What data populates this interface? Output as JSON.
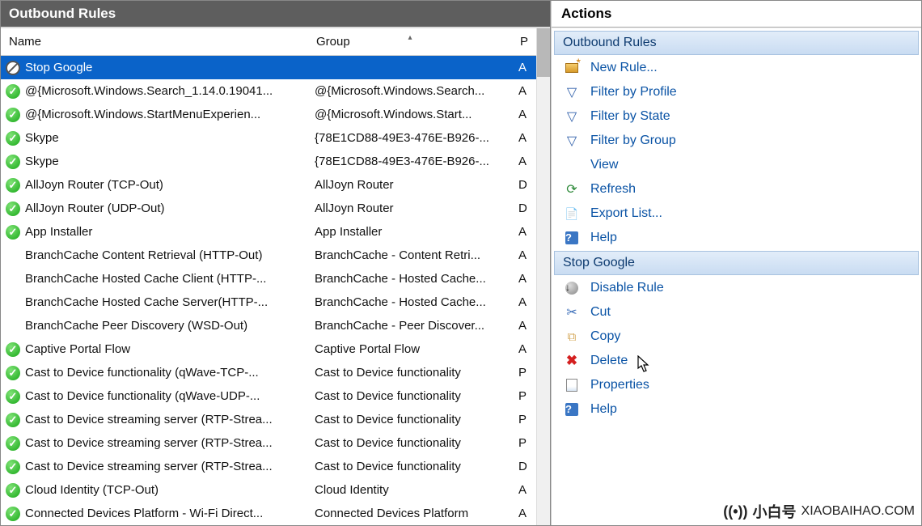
{
  "left": {
    "title": "Outbound Rules",
    "columns": {
      "name": "Name",
      "group": "Group",
      "p": "P"
    },
    "rows": [
      {
        "icon": "block",
        "name": "Stop Google",
        "group": "",
        "p": "A",
        "selected": true
      },
      {
        "icon": "allow",
        "name": "@{Microsoft.Windows.Search_1.14.0.19041...",
        "group": "@{Microsoft.Windows.Search...",
        "p": "A"
      },
      {
        "icon": "allow",
        "name": "@{Microsoft.Windows.StartMenuExperien...",
        "group": "@{Microsoft.Windows.Start...",
        "p": "A"
      },
      {
        "icon": "allow",
        "name": "Skype",
        "group": "{78E1CD88-49E3-476E-B926-...",
        "p": "A"
      },
      {
        "icon": "allow",
        "name": "Skype",
        "group": "{78E1CD88-49E3-476E-B926-...",
        "p": "A"
      },
      {
        "icon": "allow",
        "name": "AllJoyn Router (TCP-Out)",
        "group": "AllJoyn Router",
        "p": "D"
      },
      {
        "icon": "allow",
        "name": "AllJoyn Router (UDP-Out)",
        "group": "AllJoyn Router",
        "p": "D"
      },
      {
        "icon": "allow",
        "name": "App Installer",
        "group": "App Installer",
        "p": "A"
      },
      {
        "icon": "none",
        "name": "BranchCache Content Retrieval (HTTP-Out)",
        "group": "BranchCache - Content Retri...",
        "p": "A"
      },
      {
        "icon": "none",
        "name": "BranchCache Hosted Cache Client (HTTP-...",
        "group": "BranchCache - Hosted Cache...",
        "p": "A"
      },
      {
        "icon": "none",
        "name": "BranchCache Hosted Cache Server(HTTP-...",
        "group": "BranchCache - Hosted Cache...",
        "p": "A"
      },
      {
        "icon": "none",
        "name": "BranchCache Peer Discovery (WSD-Out)",
        "group": "BranchCache - Peer Discover...",
        "p": "A"
      },
      {
        "icon": "allow",
        "name": "Captive Portal Flow",
        "group": "Captive Portal Flow",
        "p": "A"
      },
      {
        "icon": "allow",
        "name": "Cast to Device functionality (qWave-TCP-...",
        "group": "Cast to Device functionality",
        "p": "P"
      },
      {
        "icon": "allow",
        "name": "Cast to Device functionality (qWave-UDP-...",
        "group": "Cast to Device functionality",
        "p": "P"
      },
      {
        "icon": "allow",
        "name": "Cast to Device streaming server (RTP-Strea...",
        "group": "Cast to Device functionality",
        "p": "P"
      },
      {
        "icon": "allow",
        "name": "Cast to Device streaming server (RTP-Strea...",
        "group": "Cast to Device functionality",
        "p": "P"
      },
      {
        "icon": "allow",
        "name": "Cast to Device streaming server (RTP-Strea...",
        "group": "Cast to Device functionality",
        "p": "D"
      },
      {
        "icon": "allow",
        "name": "Cloud Identity (TCP-Out)",
        "group": "Cloud Identity",
        "p": "A"
      },
      {
        "icon": "allow",
        "name": "Connected Devices Platform - Wi-Fi Direct...",
        "group": "Connected Devices Platform",
        "p": "A"
      }
    ]
  },
  "right": {
    "title": "Actions",
    "section1": {
      "header": "Outbound Rules",
      "items": [
        {
          "id": "new-rule",
          "label": "New Rule...",
          "icon": "newrule"
        },
        {
          "id": "filter-profile",
          "label": "Filter by Profile",
          "icon": "filter"
        },
        {
          "id": "filter-state",
          "label": "Filter by State",
          "icon": "filter"
        },
        {
          "id": "filter-group",
          "label": "Filter by Group",
          "icon": "filter"
        },
        {
          "id": "view",
          "label": "View",
          "icon": ""
        },
        {
          "id": "refresh",
          "label": "Refresh",
          "icon": "refresh"
        },
        {
          "id": "export",
          "label": "Export List...",
          "icon": "export"
        },
        {
          "id": "help1",
          "label": "Help",
          "icon": "help"
        }
      ]
    },
    "section2": {
      "header": "Stop Google",
      "items": [
        {
          "id": "disable-rule",
          "label": "Disable Rule",
          "icon": "disable"
        },
        {
          "id": "cut",
          "label": "Cut",
          "icon": "cut"
        },
        {
          "id": "copy",
          "label": "Copy",
          "icon": "copy"
        },
        {
          "id": "delete",
          "label": "Delete",
          "icon": "delete"
        },
        {
          "id": "properties",
          "label": "Properties",
          "icon": "props"
        },
        {
          "id": "help2",
          "label": "Help",
          "icon": "help"
        }
      ]
    }
  },
  "watermark": {
    "cn": "小白号",
    "en": "XIAOBAIHAO.COM"
  }
}
